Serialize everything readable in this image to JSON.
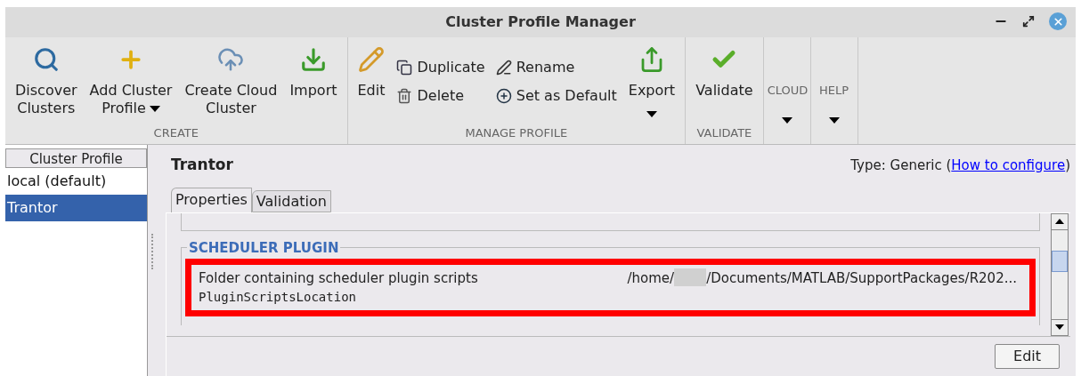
{
  "window": {
    "title": "Cluster Profile Manager"
  },
  "toolbar": {
    "groups": [
      {
        "label": "CREATE",
        "items": [
          {
            "kind": "large",
            "lines": [
              "Discover",
              "Clusters"
            ],
            "dropdown": false
          },
          {
            "kind": "large",
            "lines": [
              "Add Cluster",
              "Profile"
            ],
            "dropdown": true
          },
          {
            "kind": "large",
            "lines": [
              "Create Cloud",
              "Cluster"
            ],
            "dropdown": false
          },
          {
            "kind": "large",
            "lines": [
              "Import"
            ],
            "dropdown": false
          }
        ]
      },
      {
        "label": "MANAGE PROFILE",
        "items": [
          {
            "kind": "large",
            "lines": [
              "Edit"
            ],
            "dropdown": false
          },
          {
            "kind": "small",
            "lines": [
              "Duplicate"
            ]
          },
          {
            "kind": "small",
            "lines": [
              "Delete"
            ]
          },
          {
            "kind": "small",
            "lines": [
              "Rename"
            ]
          },
          {
            "kind": "small",
            "lines": [
              "Set as Default"
            ]
          },
          {
            "kind": "large",
            "lines": [
              "Export"
            ],
            "dropdown": true
          }
        ]
      },
      {
        "label": "VALIDATE",
        "items": [
          {
            "kind": "large",
            "lines": [
              "Validate"
            ],
            "dropdown": false
          }
        ]
      },
      {
        "label": "CLOUD",
        "items": [
          {
            "kind": "menu"
          }
        ]
      },
      {
        "label": "HELP",
        "items": [
          {
            "kind": "menu"
          }
        ]
      }
    ]
  },
  "sidebar": {
    "header": "Cluster Profile",
    "items": [
      {
        "label": "local (default)",
        "selected": false
      },
      {
        "label": "Trantor",
        "selected": true
      }
    ]
  },
  "profile": {
    "name": "Trantor",
    "type_prefix": "Type: Generic (",
    "type_link": "How to configure",
    "type_suffix": ")",
    "tabs": [
      {
        "label": "Properties",
        "selected": true
      },
      {
        "label": "Validation",
        "selected": false
      }
    ],
    "section": {
      "title": "SCHEDULER PLUGIN",
      "property": {
        "description": "Folder containing scheduler plugin scripts",
        "name": "PluginScriptsLocation",
        "value_start": "/home/",
        "value_end": "/Documents/MATLAB/SupportPackages/R202...",
        "redacted": true,
        "highlighted": true
      }
    },
    "edit_button": "Edit"
  }
}
